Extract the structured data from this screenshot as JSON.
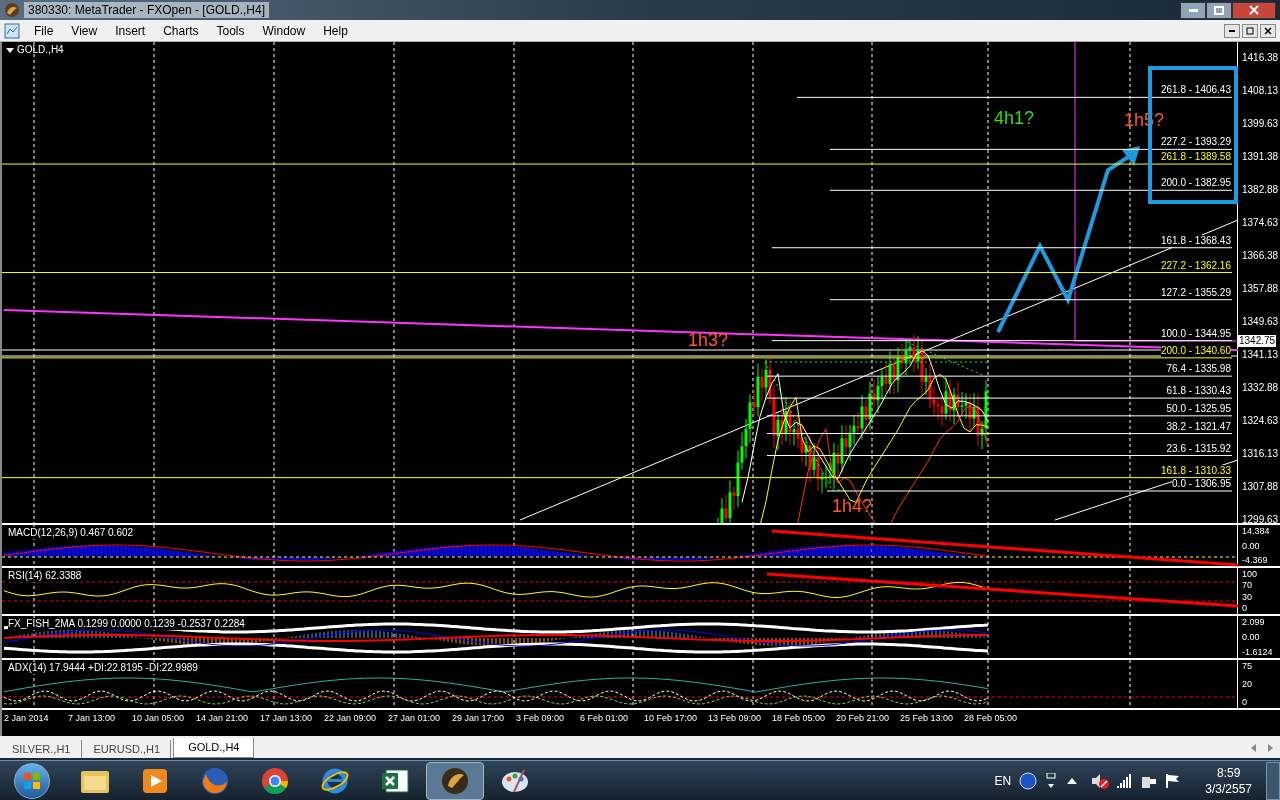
{
  "window": {
    "title": "380330: MetaTrader - FXOpen - [GOLD.,H4]"
  },
  "menu": [
    "File",
    "View",
    "Insert",
    "Charts",
    "Tools",
    "Window",
    "Help"
  ],
  "chart": {
    "symbol": "GOLD.,H4",
    "price_axis": [
      "1416.38",
      "1408.13",
      "1399.63",
      "1391.38",
      "1382.88",
      "1374.63",
      "1366.38",
      "1357.88",
      "1349.63",
      "1341.13",
      "1332.88",
      "1324.63",
      "1316.13",
      "1307.88",
      "1299.63"
    ],
    "current_price": "1342.75",
    "fib_levels": [
      {
        "label": "261.8 - 1406.43",
        "color": "#ffffff"
      },
      {
        "label": "227.2 - 1393.29",
        "color": "#ffffff"
      },
      {
        "label": "261.8 - 1389.58",
        "color": "#ffff00"
      },
      {
        "label": "200.0 - 1382.95",
        "color": "#ffffff"
      },
      {
        "label": "161.8 - 1368.43",
        "color": "#ffffff"
      },
      {
        "label": "227.2 - 1362.16",
        "color": "#ffff00"
      },
      {
        "label": "127.2 - 1355.29",
        "color": "#ffffff"
      },
      {
        "label": "100.0 - 1344.95",
        "color": "#ffffff"
      },
      {
        "label": "200.0 - 1340.60",
        "color": "#ffff00"
      },
      {
        "label": "76.4 - 1335.98",
        "color": "#ffffff"
      },
      {
        "label": "61.8 - 1330.43",
        "color": "#ffffff"
      },
      {
        "label": "50.0 - 1325.95",
        "color": "#ffffff"
      },
      {
        "label": "38.2 - 1321.47",
        "color": "#ffffff"
      },
      {
        "label": "23.6 - 1315.92",
        "color": "#ffffff"
      },
      {
        "label": "161.8 - 1310.33",
        "color": "#ffff00"
      },
      {
        "label": "0.0 - 1306.95",
        "color": "#ffffff"
      }
    ],
    "annotations": [
      {
        "text": "1h3?",
        "color": "#ff5a1f"
      },
      {
        "text": "4h1?",
        "color": "#33dd11"
      },
      {
        "text": "1h5?",
        "color": "#ff5a1f"
      },
      {
        "text": "1h4?",
        "color": "#ff5a1f"
      }
    ]
  },
  "indicators": [
    {
      "kind": "macd",
      "label": "MACD(12,26,9) 0.467 0.602",
      "axis": [
        "14.384",
        "0.00",
        "-4.369"
      ]
    },
    {
      "kind": "rsi",
      "label": "RSI(14) 62.3388",
      "axis": [
        "100",
        "70",
        "30",
        "0"
      ]
    },
    {
      "kind": "fisher",
      "label": "FX_FISH_2MA 0.1299 0.0000 0.1239 -0.2537 0.2284",
      "axis": [
        "2.099",
        "0.00",
        "-1.6124"
      ]
    },
    {
      "kind": "adx",
      "label": "ADX(14) 17.9444 +DI:22.8195 -DI:22.9989",
      "axis": [
        "75",
        "20",
        "0"
      ]
    }
  ],
  "time_axis": [
    "2 Jan 2014",
    "7 Jan 13:00",
    "10 Jan 05:00",
    "14 Jan 21:00",
    "17 Jan 13:00",
    "22 Jan 09:00",
    "27 Jan 01:00",
    "29 Jan 17:00",
    "3 Feb 09:00",
    "6 Feb 01:00",
    "10 Feb 17:00",
    "13 Feb 09:00",
    "18 Feb 05:00",
    "20 Feb 21:00",
    "25 Feb 13:00",
    "28 Feb 05:00"
  ],
  "tabs": [
    {
      "label": "SILVER.,H1",
      "selected": false
    },
    {
      "label": "EURUSD.,H1",
      "selected": false
    },
    {
      "label": "GOLD.,H4",
      "selected": true
    }
  ],
  "taskbar": {
    "apps": [
      {
        "kind": "folder",
        "selected": false
      },
      {
        "kind": "media",
        "selected": false
      },
      {
        "kind": "firefox",
        "selected": false
      },
      {
        "kind": "chrome",
        "selected": false
      },
      {
        "kind": "ie",
        "selected": false
      },
      {
        "kind": "spreadsheet",
        "selected": false
      },
      {
        "kind": "trader",
        "selected": true
      },
      {
        "kind": "paint",
        "selected": false
      }
    ],
    "language": "EN",
    "time": "8:59",
    "date": "3/3/2557"
  }
}
